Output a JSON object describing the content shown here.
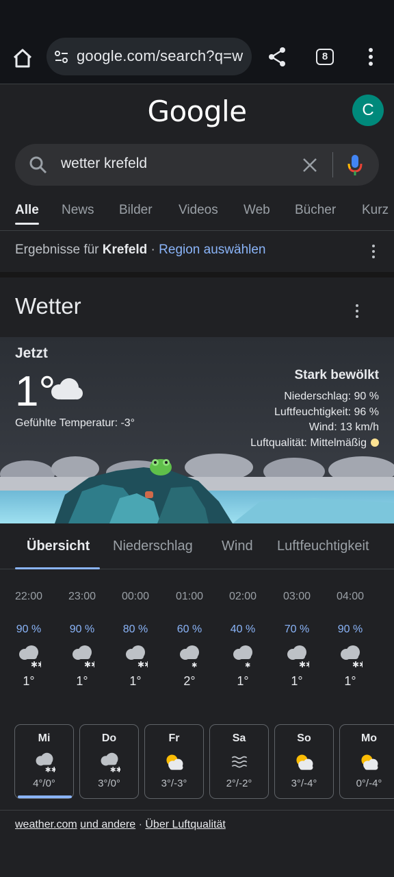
{
  "browser": {
    "url": "google.com/search?q=w",
    "tab_count": "8"
  },
  "header": {
    "logo": "Google",
    "avatar_letter": "C"
  },
  "search": {
    "query": "wetter krefeld"
  },
  "filters": [
    "Alle",
    "News",
    "Bilder",
    "Videos",
    "Web",
    "Bücher",
    "Kurz"
  ],
  "region": {
    "prefix": "Ergebnisse für",
    "place": "Krefeld",
    "separator": "·",
    "link": "Region auswählen"
  },
  "weather": {
    "title": "Wetter",
    "now_label": "Jetzt",
    "temperature": "1°",
    "feels_like": "Gefühlte Temperatur: -3°",
    "condition": "Stark bewölkt",
    "precipitation": "Niederschlag: 90 %",
    "humidity": "Luftfeuchtigkeit: 96 %",
    "wind": "Wind: 13 km/h",
    "air_quality": "Luftqualität: Mittelmäßig",
    "air_quality_color": "#fde293",
    "tabs": [
      "Übersicht",
      "Niederschlag",
      "Wind",
      "Luftfeuchtigkeit"
    ],
    "hourly": [
      {
        "time": "22:00",
        "precip": "90 %",
        "icon": "snow-cloud-icon",
        "temp": "1°"
      },
      {
        "time": "23:00",
        "precip": "90 %",
        "icon": "snow-cloud-icon",
        "temp": "1°"
      },
      {
        "time": "00:00",
        "precip": "80 %",
        "icon": "snow-cloud-icon",
        "temp": "1°"
      },
      {
        "time": "01:00",
        "precip": "60 %",
        "icon": "light-snow-cloud-icon",
        "temp": "2°"
      },
      {
        "time": "02:00",
        "precip": "40 %",
        "icon": "light-snow-cloud-icon",
        "temp": "1°"
      },
      {
        "time": "03:00",
        "precip": "70 %",
        "icon": "snow-cloud-icon",
        "temp": "1°"
      },
      {
        "time": "04:00",
        "precip": "90 %",
        "icon": "snow-cloud-icon",
        "temp": "1°"
      }
    ],
    "daily": [
      {
        "day": "Mi",
        "icon": "snow-cloud-icon",
        "range": "4°/0°"
      },
      {
        "day": "Do",
        "icon": "snow-cloud-icon",
        "range": "3°/0°"
      },
      {
        "day": "Fr",
        "icon": "partly-sunny-icon",
        "range": "3°/-3°"
      },
      {
        "day": "Sa",
        "icon": "fog-icon",
        "range": "2°/-2°"
      },
      {
        "day": "So",
        "icon": "partly-sunny-icon",
        "range": "3°/-4°"
      },
      {
        "day": "Mo",
        "icon": "partly-sunny-icon",
        "range": "0°/-4°"
      }
    ],
    "source_link": "weather.com",
    "source_others": "und andere",
    "source_separator": "·",
    "air_quality_link": "Über Luftqualität"
  }
}
